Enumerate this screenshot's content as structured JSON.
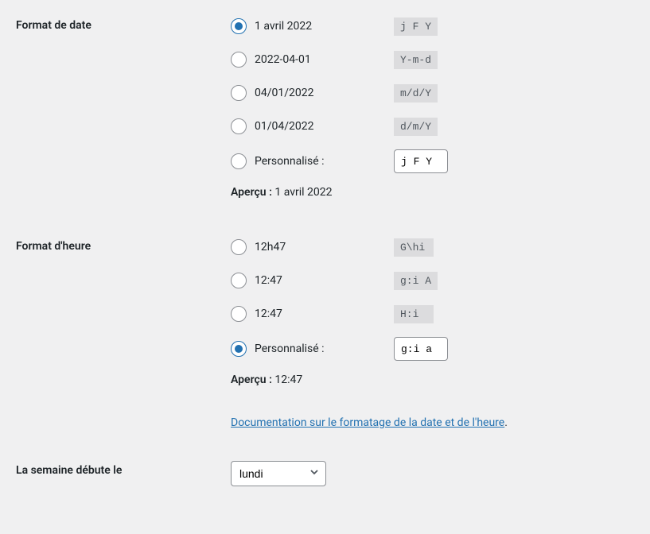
{
  "dateFormat": {
    "label": "Format de date",
    "options": [
      {
        "display": "1 avril 2022",
        "code": "j F Y",
        "checked": true
      },
      {
        "display": "2022-04-01",
        "code": "Y-m-d",
        "checked": false
      },
      {
        "display": "04/01/2022",
        "code": "m/d/Y",
        "checked": false
      },
      {
        "display": "01/04/2022",
        "code": "d/m/Y",
        "checked": false
      }
    ],
    "customLabel": "Personnalisé :",
    "customValue": "j F Y",
    "customChecked": false,
    "previewLabel": "Aperçu :",
    "previewValue": "1 avril 2022"
  },
  "timeFormat": {
    "label": "Format d'heure",
    "options": [
      {
        "display": "12h47",
        "code": "G\\hi",
        "checked": false
      },
      {
        "display": "12:47",
        "code": "g:i A",
        "checked": false
      },
      {
        "display": "12:47",
        "code": "H:i",
        "checked": false
      }
    ],
    "customLabel": "Personnalisé :",
    "customValue": "g:i a",
    "customChecked": true,
    "previewLabel": "Aperçu :",
    "previewValue": "12:47",
    "docLinkText": "Documentation sur le formatage de la date et de l'heure",
    "docLinkPeriod": "."
  },
  "weekStart": {
    "label": "La semaine débute le",
    "selected": "lundi"
  }
}
